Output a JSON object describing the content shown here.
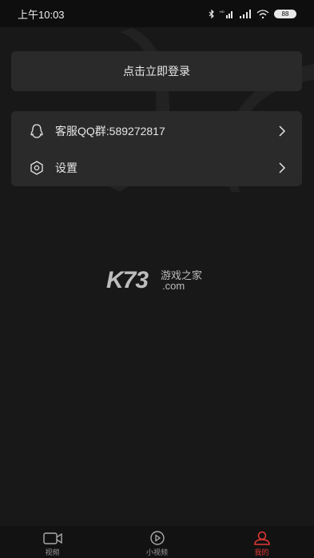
{
  "status_bar": {
    "time": "上午10:03",
    "battery": "88"
  },
  "login": {
    "label": "点击立即登录"
  },
  "menu": {
    "items": [
      {
        "label": "客服QQ群:589272817",
        "icon": "qq-penguin-icon"
      },
      {
        "label": "设置",
        "icon": "settings-hexagon-icon"
      }
    ]
  },
  "watermark": {
    "brand": "K73",
    "tagline": "游戏之家",
    "domain": ".com"
  },
  "tabs": [
    {
      "label": "视频",
      "icon": "video-camera-icon",
      "active": false
    },
    {
      "label": "小视频",
      "icon": "play-circle-icon",
      "active": false
    },
    {
      "label": "我的",
      "icon": "user-icon",
      "active": true
    }
  ],
  "colors": {
    "background": "#181818",
    "card": "#2a2a2a",
    "accent": "#e53935"
  }
}
